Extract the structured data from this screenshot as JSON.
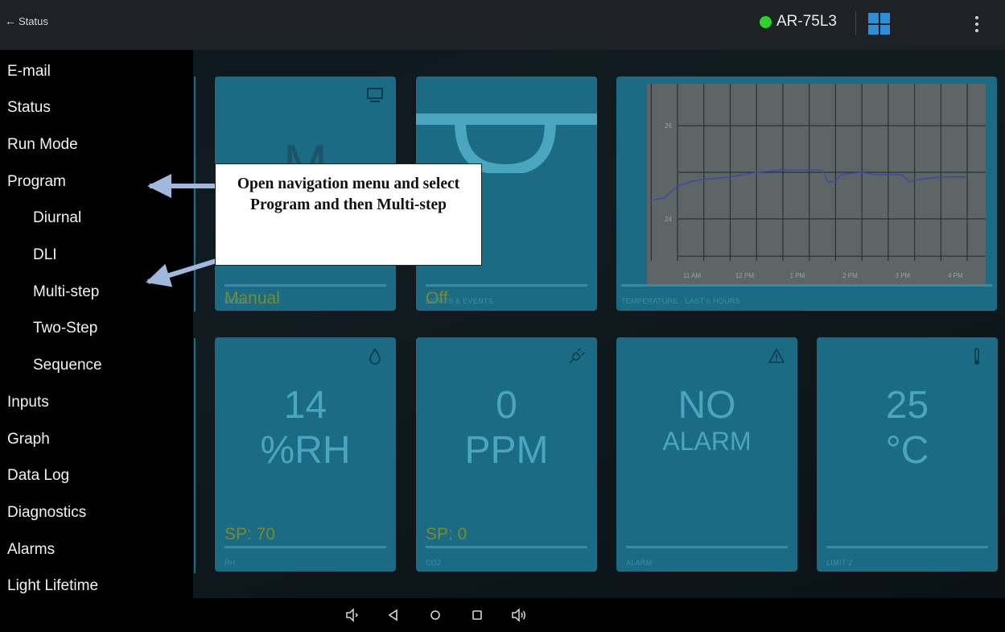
{
  "topbar": {
    "back_label": "Status",
    "device_name": "AR-75L3",
    "status_color": "#2fd12f",
    "accent": "#2e8fd6"
  },
  "sidebar": {
    "items": [
      {
        "label": "E-mail"
      },
      {
        "label": "Status"
      },
      {
        "label": "Run Mode"
      },
      {
        "label": "Program"
      },
      {
        "label": "Diurnal"
      },
      {
        "label": "DLI"
      },
      {
        "label": "Multi-step"
      },
      {
        "label": "Two-Step"
      },
      {
        "label": "Sequence"
      },
      {
        "label": "Inputs"
      },
      {
        "label": "Graph"
      },
      {
        "label": "Data Log"
      },
      {
        "label": "Diagnostics"
      },
      {
        "label": "Alarms"
      },
      {
        "label": "Light Lifetime"
      }
    ]
  },
  "cards": {
    "mode": {
      "big": "M",
      "value": "Manual",
      "label": "MODE",
      "icon": "monitor-icon"
    },
    "lights": {
      "value": "Off",
      "label": "LIGHTS & EVENTS"
    },
    "temperature_chart": {
      "label": "TEMPERATURE - LAST 6 HOURS"
    },
    "rh": {
      "value": "14",
      "unit": "%RH",
      "sp": "SP: 70",
      "label": "RH",
      "icon": "drop-icon"
    },
    "co2": {
      "value": "0",
      "unit": "PPM",
      "sp": "SP: 0",
      "label": "CO2",
      "icon": "plug-icon"
    },
    "alarm": {
      "value": "NO",
      "unit": "ALARM",
      "label": "ALARM",
      "icon": "alarm-bell-icon"
    },
    "limit": {
      "value": "25",
      "unit": "°C",
      "label": "LIMIT 2",
      "icon": "thermometer-icon"
    }
  },
  "annotation": {
    "text": "Open navigation menu and select Program and then Multi-step"
  },
  "chart_data": {
    "type": "line",
    "title": "",
    "xlabel": "",
    "ylabel": "",
    "x": [
      "11 AM",
      "12 PM",
      "1 PM",
      "2 PM",
      "3 PM",
      "4 PM"
    ],
    "yticks": [
      24,
      26
    ],
    "ylim": [
      23.1,
      26.9
    ],
    "grid": true,
    "points": [
      [
        10.5,
        24.4
      ],
      [
        10.75,
        24.45
      ],
      [
        11.0,
        24.7
      ],
      [
        11.25,
        24.8
      ],
      [
        11.5,
        24.85
      ],
      [
        12.0,
        24.9
      ],
      [
        12.25,
        24.95
      ],
      [
        12.5,
        25.0
      ],
      [
        13.0,
        25.05
      ],
      [
        13.5,
        25.05
      ],
      [
        13.75,
        25.05
      ],
      [
        13.85,
        24.8
      ],
      [
        14.0,
        24.8
      ],
      [
        14.1,
        24.95
      ],
      [
        14.5,
        25.0
      ],
      [
        14.75,
        24.95
      ],
      [
        15.0,
        24.95
      ],
      [
        15.25,
        24.95
      ],
      [
        15.4,
        24.8
      ],
      [
        15.6,
        24.85
      ],
      [
        16.0,
        24.9
      ],
      [
        16.5,
        24.9
      ]
    ]
  }
}
